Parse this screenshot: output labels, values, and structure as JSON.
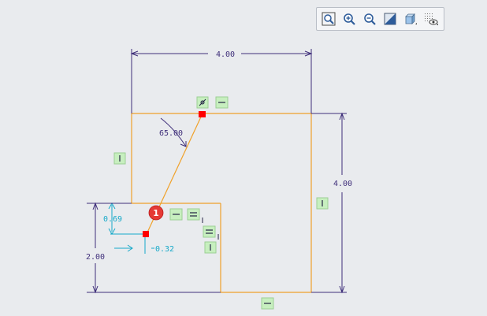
{
  "toolbar": {
    "buttons": [
      {
        "name": "refit-view-icon"
      },
      {
        "name": "zoom-in-icon"
      },
      {
        "name": "zoom-out-icon"
      },
      {
        "name": "repaint-icon"
      },
      {
        "name": "display-style-icon"
      },
      {
        "name": "sketcher-display-filter-icon"
      }
    ]
  },
  "dimensions": {
    "top_width": "4.00",
    "right_height": "4.00",
    "angle": "65.00",
    "small_height": "0.69",
    "small_offset": "0.32",
    "left_height": "2.00"
  },
  "callout": {
    "number": "1"
  },
  "colors": {
    "geometry": "#f0a12a",
    "dimension_strong": "#3f2f7a",
    "dimension_weak": "#17a9c9",
    "constraint_bg": "#c7efbf",
    "point": "#ff0000",
    "callout": "#e53935"
  }
}
